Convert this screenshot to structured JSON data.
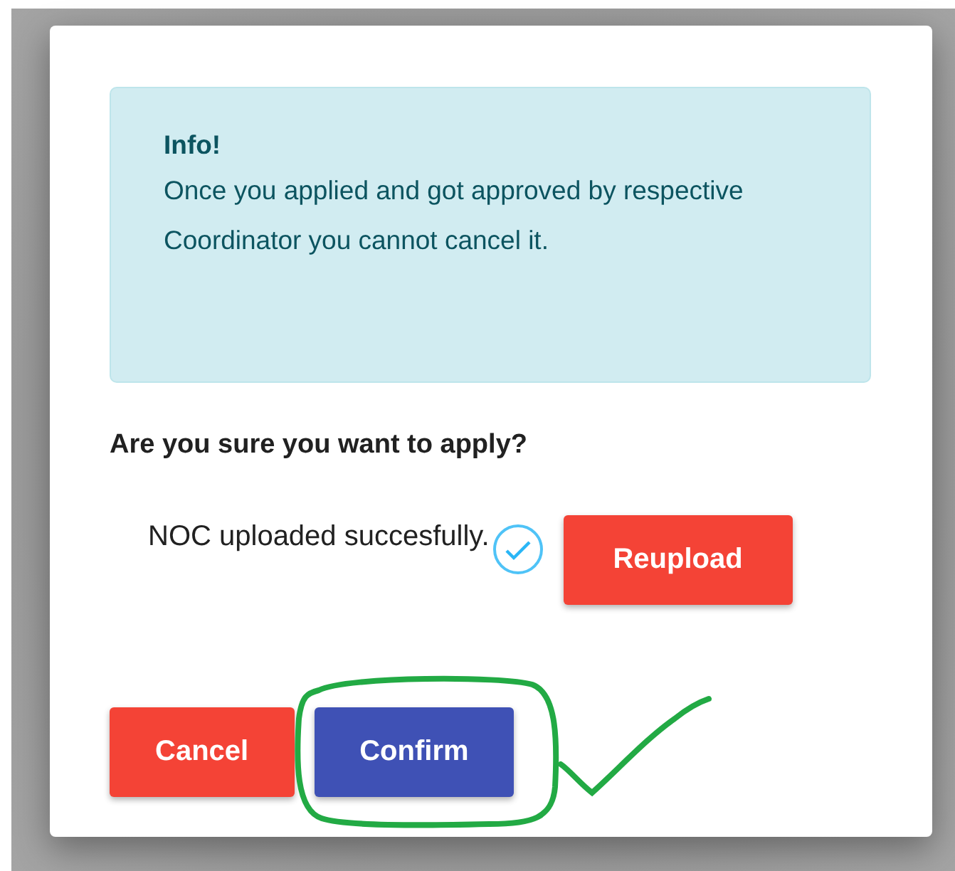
{
  "alert": {
    "title": "Info!",
    "message": "Once you applied and got approved by respective Coordinator you cannot cancel it."
  },
  "question": "Are you sure you want to apply?",
  "upload": {
    "message": "NOC uploaded succesfully.",
    "uploaded": true,
    "button": "Reupload"
  },
  "buttons": [
    {
      "label": "Cancel",
      "kind": "danger"
    },
    {
      "label": "Confirm",
      "kind": "primary"
    }
  ]
}
